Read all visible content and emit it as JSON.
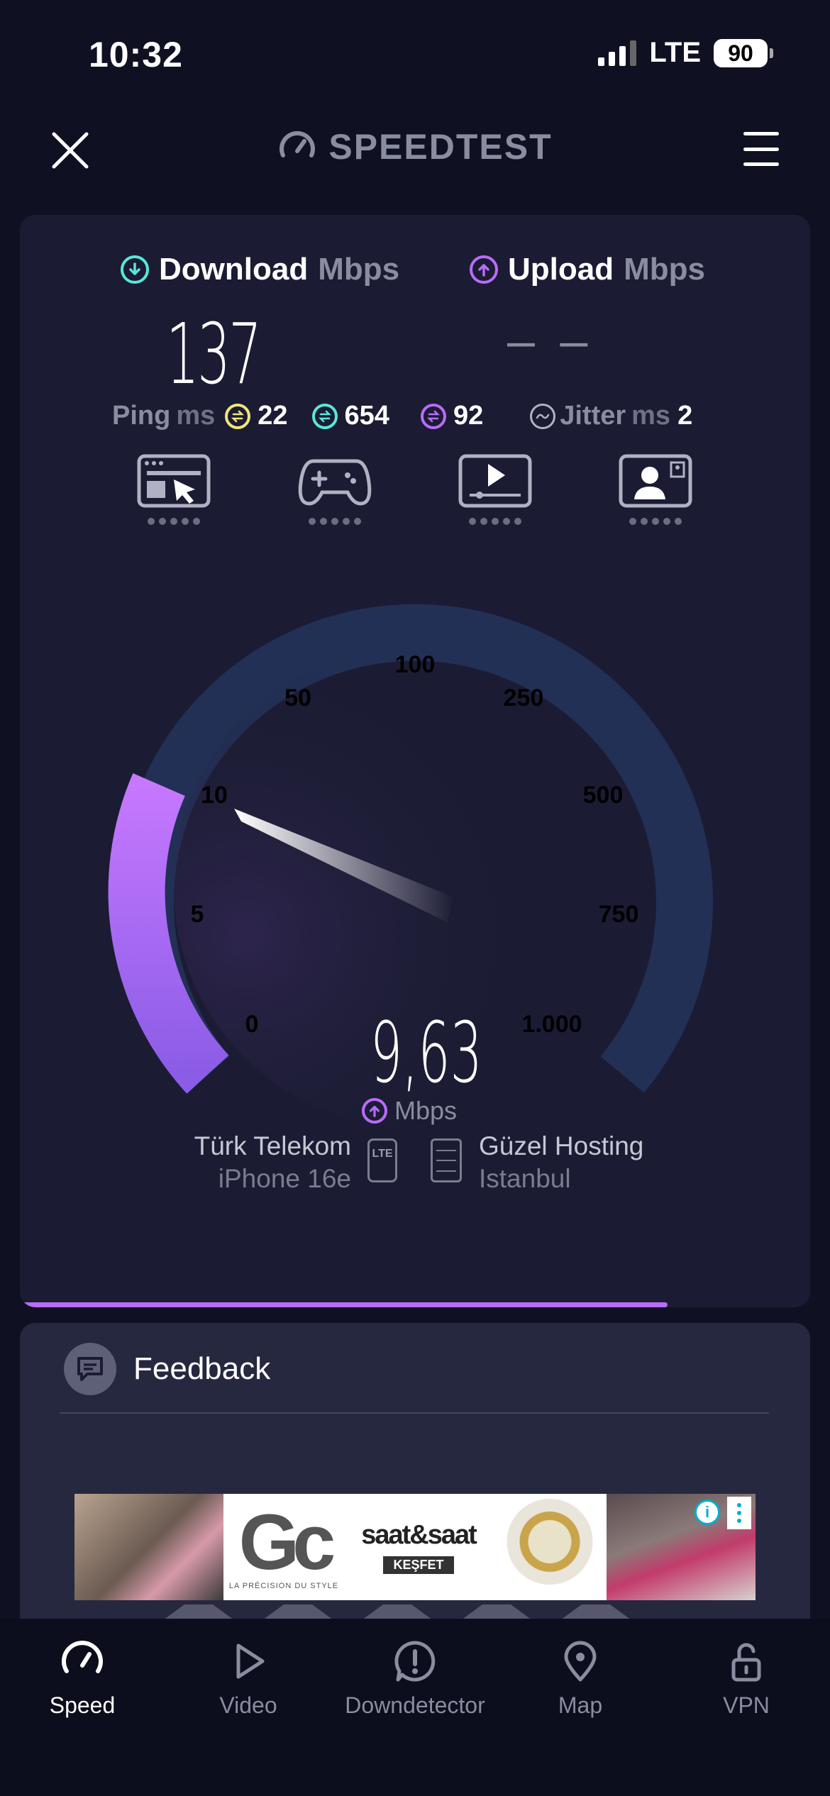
{
  "status_bar": {
    "time": "10:32",
    "network": "LTE",
    "battery": "90"
  },
  "header": {
    "logo_text": "SPEEDTEST",
    "logo_icon": "speedometer-icon",
    "close_icon": "close-icon",
    "menu_icon": "hamburger-menu-icon"
  },
  "results": {
    "download": {
      "label": "Download",
      "unit": "Mbps",
      "value": "137",
      "color": "#5ae6d8"
    },
    "upload": {
      "label": "Upload",
      "unit": "Mbps",
      "value": "– –",
      "color": "#b86cf8"
    },
    "ping": {
      "label": "Ping",
      "unit": "ms",
      "idle": "22",
      "download": "654",
      "upload": "92",
      "idle_color": "#f3e57a",
      "download_color": "#5ae6d8",
      "upload_color": "#b86cf8"
    },
    "jitter": {
      "label": "Jitter",
      "unit": "ms",
      "value": "2"
    }
  },
  "usage_icons": [
    "web-browsing-icon",
    "gaming-icon",
    "video-streaming-icon",
    "video-call-icon"
  ],
  "gauge": {
    "ticks": [
      "0",
      "5",
      "10",
      "50",
      "100",
      "250",
      "500",
      "750",
      "1.000"
    ],
    "current_value": "9,63",
    "unit": "Mbps",
    "accent": "#b86cf8",
    "track": "#223056"
  },
  "connection": {
    "isp_name": "Türk Telekom",
    "device": "iPhone 16e",
    "network_badge": "LTE",
    "server_name": "Güzel Hosting",
    "server_location": "Istanbul"
  },
  "progress": {
    "fraction": 0.82
  },
  "feedback": {
    "label": "Feedback"
  },
  "ad": {
    "logo": "Gc",
    "tagline": "LA PRÉCISION DU STYLE",
    "brand": "saat&saat",
    "brand_sub": "KEŞFET",
    "info": "i"
  },
  "tabs": [
    {
      "label": "Speed",
      "icon": "speed-gauge-icon",
      "active": true
    },
    {
      "label": "Video",
      "icon": "play-icon",
      "active": false
    },
    {
      "label": "Downdetector",
      "icon": "alert-icon",
      "active": false
    },
    {
      "label": "Map",
      "icon": "map-pin-icon",
      "active": false
    },
    {
      "label": "VPN",
      "icon": "unlock-icon",
      "active": false
    }
  ]
}
